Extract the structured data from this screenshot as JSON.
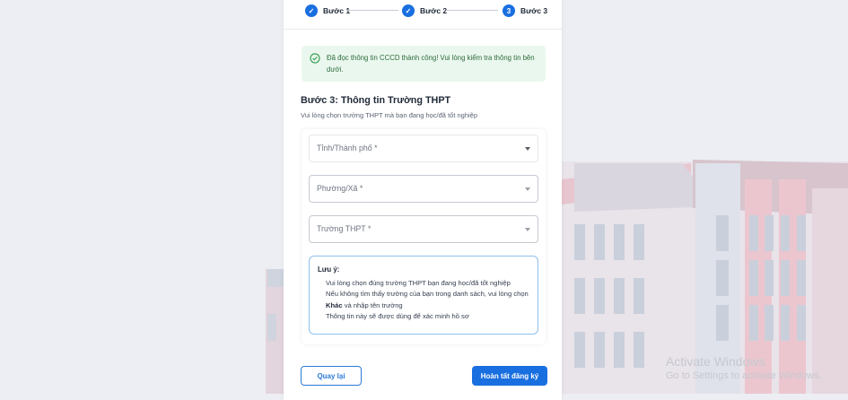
{
  "stepper": {
    "steps": [
      {
        "label": "Bước 1",
        "state": "done"
      },
      {
        "label": "Bước 2",
        "state": "done"
      },
      {
        "label": "Bước 3",
        "number": "3",
        "state": "current"
      }
    ]
  },
  "alert": {
    "icon": "check-circle-icon",
    "message": "Đã đọc thông tin CCCD thành công! Vui lòng kiểm tra thông tin bên dưới."
  },
  "step3": {
    "title": "Bước 3: Thông tin Trường THPT",
    "subtitle": "Vui lòng chọn trường THPT mà bạn đang học/đã tốt nghiệp"
  },
  "form": {
    "province_placeholder": "Tỉnh/Thành phố *",
    "ward_placeholder": "Phường/Xã *",
    "school_placeholder": "Trường THPT *"
  },
  "note": {
    "title": "Lưu ý:",
    "line1": "Vui lòng chọn đúng trường THPT bạn đang học/đã tốt nghiệp",
    "line2_before": "Nếu không tìm thấy trường của bạn trong danh sách, vui lòng chọn",
    "line2_bold": "Khác",
    "line2_after": "và nhập tên trường",
    "line3": "Thông tin này sẽ được dùng để xác minh hồ sơ"
  },
  "buttons": {
    "back": "Quay lại",
    "submit": "Hoàn tất đăng ký"
  },
  "watermark": {
    "line1": "Activate Windows",
    "line2": "Go to Settings to activate Windows."
  },
  "colors": {
    "primary": "#1a6fe0",
    "success_bg": "#eaf7ee",
    "success_text": "#2d6b3b",
    "note_border": "#8fc0ec"
  }
}
